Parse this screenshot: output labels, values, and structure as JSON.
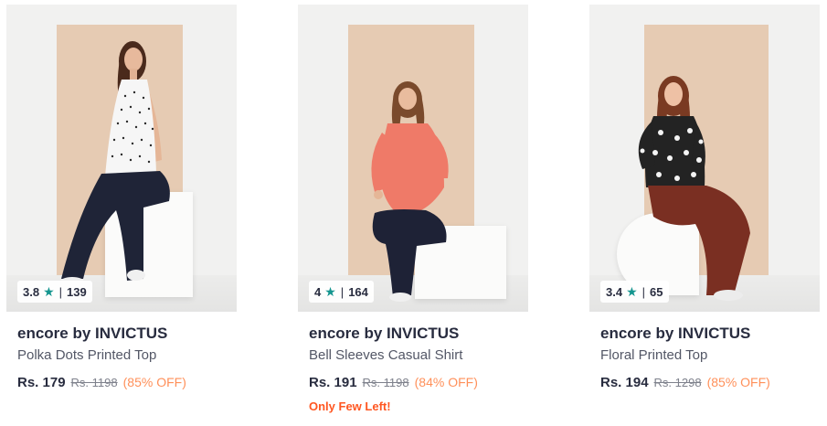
{
  "products": [
    {
      "rating": "3.8",
      "rating_count": "139",
      "brand": "encore by INVICTUS",
      "name": "Polka Dots Printed Top",
      "price": "Rs. 179",
      "mrp": "Rs. 1198",
      "discount": "(85% OFF)",
      "stock_note": "",
      "image_desc": "model-polka-dots-top"
    },
    {
      "rating": "4",
      "rating_count": "164",
      "brand": "encore by INVICTUS",
      "name": "Bell Sleeves Casual Shirt",
      "price": "Rs. 191",
      "mrp": "Rs. 1198",
      "discount": "(84% OFF)",
      "stock_note": "Only Few Left!",
      "image_desc": "model-bell-sleeves-shirt"
    },
    {
      "rating": "3.4",
      "rating_count": "65",
      "brand": "encore by INVICTUS",
      "name": "Floral Printed Top",
      "price": "Rs. 194",
      "mrp": "Rs. 1298",
      "discount": "(85% OFF)",
      "stock_note": "",
      "image_desc": "model-floral-top"
    }
  ],
  "colors": {
    "star": "#14958f",
    "discount": "#ff905a",
    "stock_warning": "#ff5722",
    "text_primary": "#282c3f",
    "backdrop": "#e6cbb3"
  },
  "icons": {
    "rating": "star-icon"
  }
}
